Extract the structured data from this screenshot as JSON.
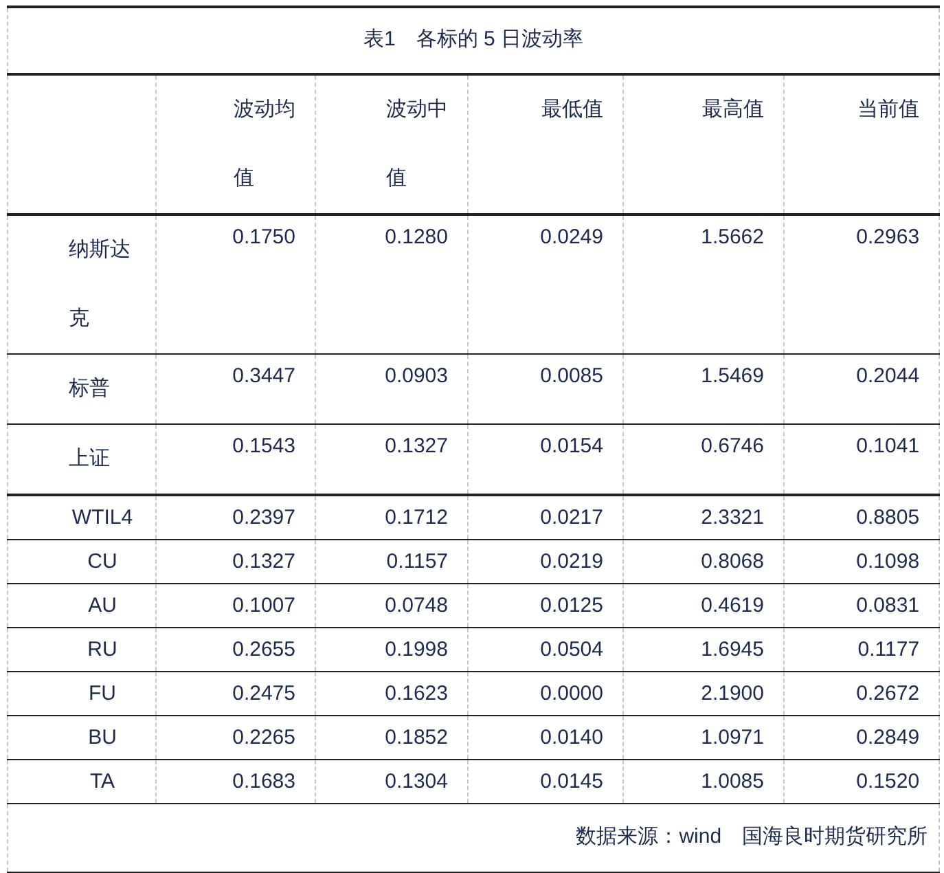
{
  "title": "表1　各标的 5 日波动率",
  "columns": [
    "波动均值",
    "波动中值",
    "最低值",
    "最高值",
    "当前值"
  ],
  "rows": [
    {
      "label": "纳斯达克",
      "kind": "tall",
      "values": [
        "0.1750",
        "0.1280",
        "0.0249",
        "1.5662",
        "0.2963"
      ]
    },
    {
      "label": "标普",
      "kind": "tall",
      "values": [
        "0.3447",
        "0.0903",
        "0.0085",
        "1.5469",
        "0.2044"
      ]
    },
    {
      "label": "上证",
      "kind": "tall",
      "values": [
        "0.1543",
        "0.1327",
        "0.0154",
        "0.6746",
        "0.1041"
      ]
    },
    {
      "label": "WTIL4",
      "kind": "short",
      "values": [
        "0.2397",
        "0.1712",
        "0.0217",
        "2.3321",
        "0.8805"
      ]
    },
    {
      "label": "CU",
      "kind": "short",
      "values": [
        "0.1327",
        "0.1157",
        "0.0219",
        "0.8068",
        "0.1098"
      ]
    },
    {
      "label": "AU",
      "kind": "short",
      "values": [
        "0.1007",
        "0.0748",
        "0.0125",
        "0.4619",
        "0.0831"
      ]
    },
    {
      "label": "RU",
      "kind": "short",
      "values": [
        "0.2655",
        "0.1998",
        "0.0504",
        "1.6945",
        "0.1177"
      ]
    },
    {
      "label": "FU",
      "kind": "short",
      "values": [
        "0.2475",
        "0.1623",
        "0.0000",
        "2.1900",
        "0.2672"
      ]
    },
    {
      "label": "BU",
      "kind": "short",
      "values": [
        "0.2265",
        "0.1852",
        "0.0140",
        "1.0971",
        "0.2849"
      ]
    },
    {
      "label": "TA",
      "kind": "short",
      "values": [
        "0.1683",
        "0.1304",
        "0.0145",
        "1.0085",
        "0.1520"
      ]
    }
  ],
  "source": "数据来源：wind　国海良时期货研究所"
}
